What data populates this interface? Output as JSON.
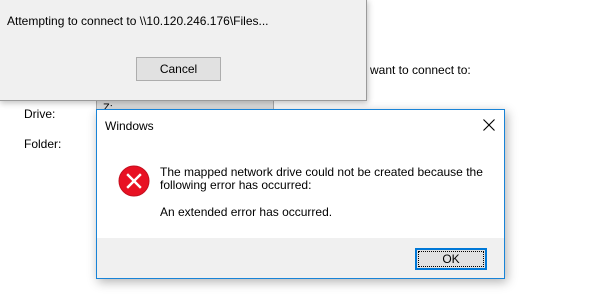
{
  "background_wizard": {
    "prompt_text": "want to connect to:",
    "drive_label": "Drive:",
    "drive_value": "Z:",
    "folder_label": "Folder:"
  },
  "connect_dialog": {
    "message": "Attempting to connect to \\\\10.120.246.176\\Files...",
    "cancel_label": "Cancel"
  },
  "error_dialog": {
    "title": "Windows",
    "message_line1": "The mapped network drive could not be created because the",
    "message_line2": "following error has occurred:",
    "detail": "An extended error has occurred.",
    "ok_label": "OK",
    "icon": "error-x-icon",
    "icon_color": "#e81123",
    "accent_color": "#0078d7"
  }
}
